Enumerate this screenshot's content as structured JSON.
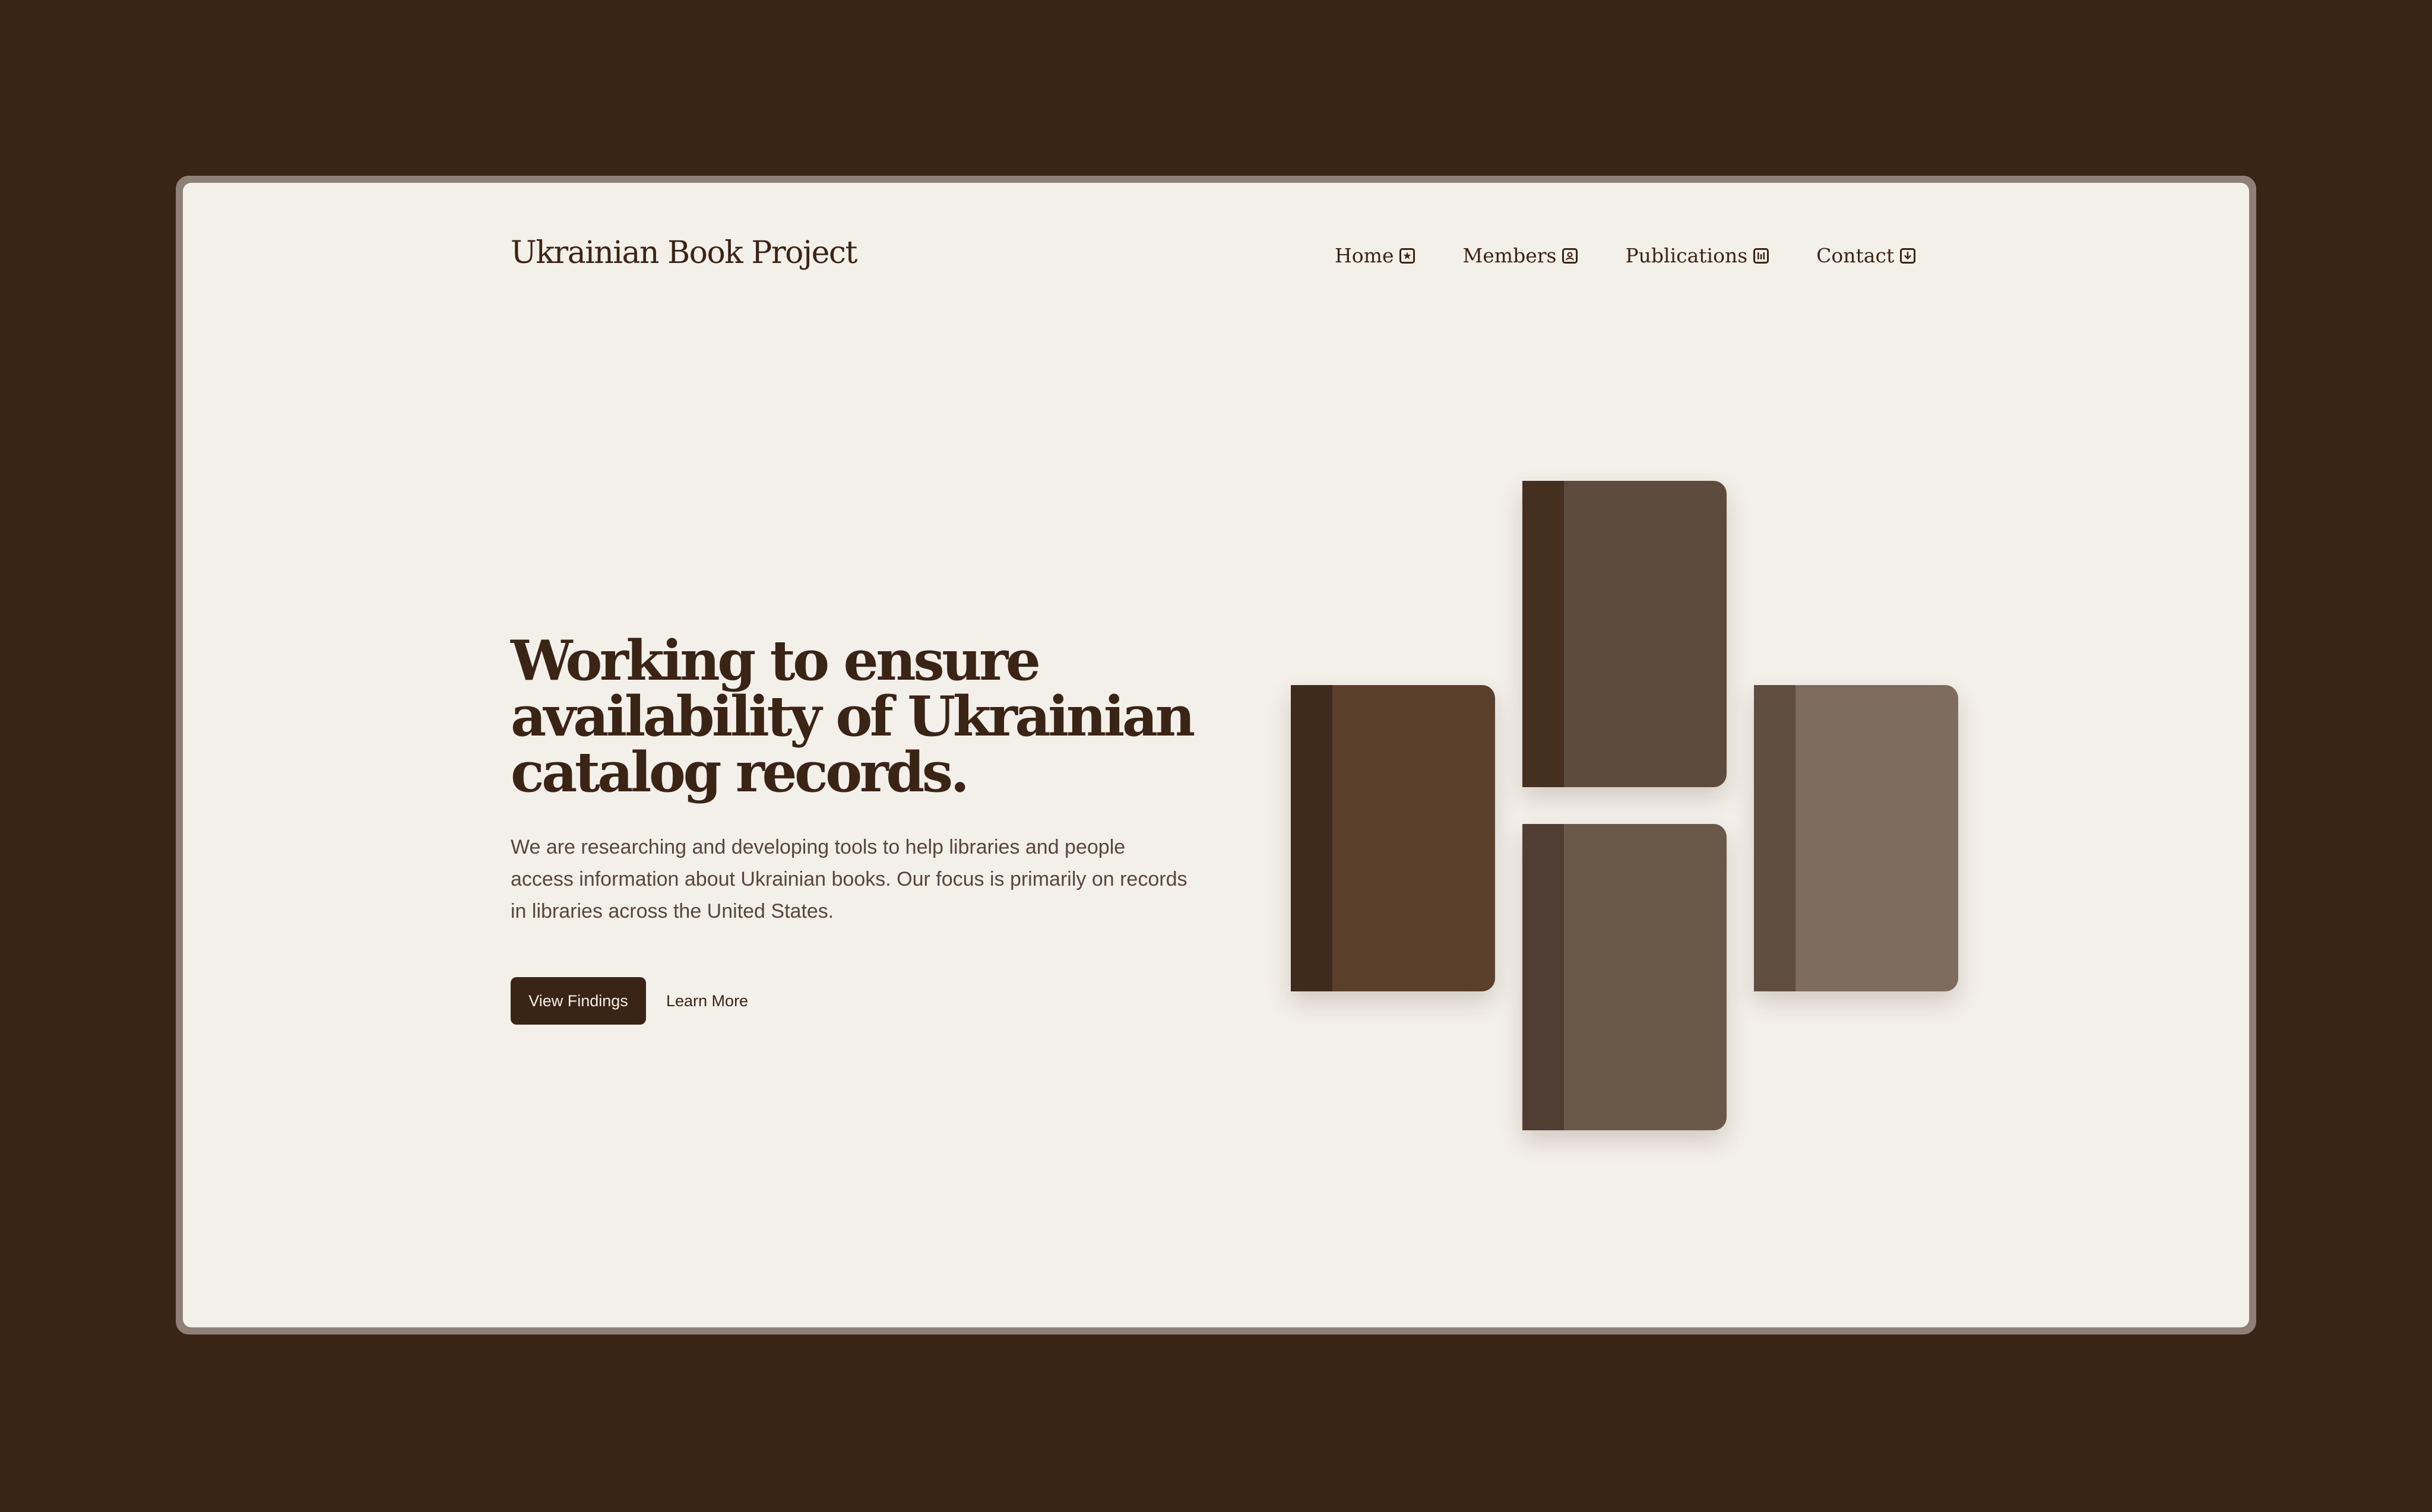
{
  "header": {
    "site_title": "Ukrainian Book Project",
    "nav": [
      {
        "label": "Home",
        "icon": "star-box-icon"
      },
      {
        "label": "Members",
        "icon": "user-box-icon"
      },
      {
        "label": "Publications",
        "icon": "columns-box-icon"
      },
      {
        "label": "Contact",
        "icon": "download-box-icon"
      }
    ]
  },
  "hero": {
    "headline": "Working to ensure availability of Ukrainian catalog records.",
    "description": "We are researching and developing tools to help libraries and people access information about Ukrainian books. Our focus is primarily on records in libraries across the United States.",
    "primary_button": "View Findings",
    "secondary_button": "Learn More"
  },
  "illustration": {
    "books": [
      {
        "name": "book-left",
        "cover": "#5a402a",
        "spine": "#3f2a1b"
      },
      {
        "name": "book-top",
        "cover": "#5d4c3d",
        "spine": "#45301f"
      },
      {
        "name": "book-bottom",
        "cover": "#6a5849",
        "spine": "#4f3e31"
      },
      {
        "name": "book-right",
        "cover": "#7e6c5e",
        "spine": "#5f4d3f"
      }
    ]
  },
  "colors": {
    "page_background": "#3a2416",
    "window_background": "#f3f0e9",
    "frame_border": "#8e8077",
    "text_primary": "#3a2416",
    "text_secondary": "#58463a",
    "button_background": "#3a2416"
  }
}
